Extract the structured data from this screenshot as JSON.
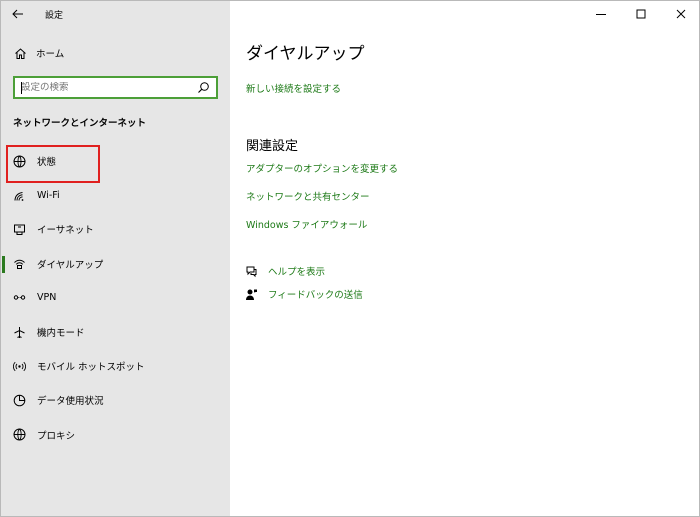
{
  "app": {
    "title": "設定"
  },
  "sidebar": {
    "home_label": "ホーム",
    "search_placeholder": "設定の検索",
    "section_header": "ネットワークとインターネット",
    "items": [
      {
        "label": "状態",
        "icon": "status-globe-icon"
      },
      {
        "label": "Wi-Fi",
        "icon": "wifi-icon"
      },
      {
        "label": "イーサネット",
        "icon": "ethernet-icon"
      },
      {
        "label": "ダイヤルアップ",
        "icon": "dialup-icon",
        "active": true
      },
      {
        "label": "VPN",
        "icon": "vpn-icon"
      },
      {
        "label": "機内モード",
        "icon": "airplane-icon"
      },
      {
        "label": "モバイル ホットスポット",
        "icon": "hotspot-icon"
      },
      {
        "label": "データ使用状況",
        "icon": "data-usage-icon"
      },
      {
        "label": "プロキシ",
        "icon": "globe-icon"
      }
    ]
  },
  "main": {
    "title": "ダイヤルアップ",
    "new_connection_link": "新しい接続を設定する",
    "related_title": "関連設定",
    "related_links": [
      "アダプターのオプションを変更する",
      "ネットワークと共有センター",
      "Windows ファイアウォール"
    ],
    "help_label": "ヘルプを表示",
    "feedback_label": "フィードバックの送信"
  },
  "colors": {
    "accent": "#1d7a17",
    "highlight": "#e0201f",
    "sidebar_bg": "#e6e6e6"
  }
}
